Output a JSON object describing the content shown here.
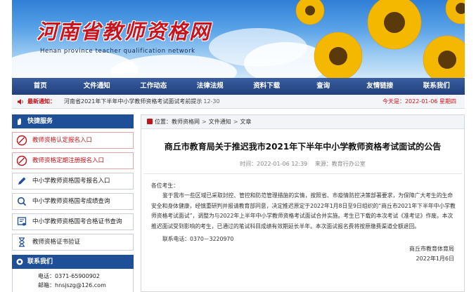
{
  "site": {
    "title": "河南省教师资格网",
    "subtitle": "Henan province teacher qualification network"
  },
  "nav": [
    "首页",
    "文件通知",
    "工作动态",
    "法律法规",
    "资料下载",
    "查询",
    "友情链接",
    "联系我们"
  ],
  "ticker": {
    "label": "最新通知：",
    "news": "河南省2021年下半年中小学教师资格考试面试考前提示",
    "news_date": "12-30",
    "today": "今天是：2022-01-06 星期四"
  },
  "sidebar": {
    "quick_title": "快捷服务",
    "items": [
      {
        "label": "教师资格认定报名入口",
        "style": "red",
        "icon": "no-entry-icon"
      },
      {
        "label": "教师资格定期注册报名入口",
        "style": "red",
        "icon": "no-entry-icon"
      },
      {
        "label": "中小学教师资格国考报名入口",
        "style": "normal",
        "icon": "pencil-icon"
      },
      {
        "label": "中小学教师资格国考成绩查询",
        "style": "normal",
        "icon": "search-icon"
      },
      {
        "label": "中小学教师资格国考合格证书查询",
        "style": "normal",
        "icon": "certificate-icon"
      },
      {
        "label": "教师资格证书验证",
        "style": "normal",
        "icon": "hourglass-icon"
      }
    ],
    "contact_title": "联系我们",
    "phone": "电话：0371-65900902",
    "email": "邮箱：hnsjszg@126.com"
  },
  "breadcrumb": {
    "prefix": "位置：",
    "items": [
      "教师资格网",
      "文件通知",
      "文章"
    ]
  },
  "article": {
    "title": "商丘市教育局关于推迟我市2021年下半年中小学教师资格考试面试的公告",
    "time": "时间：2022-01-06 12:39",
    "source": "来源：教育行办公室",
    "greeting": "各位考生：",
    "paragraph": "鉴于我市一些区域已采取封控、管控和防范管理措施的实情，按照省、市疫情防控决策部署要求，为保障广大考生的生命安全和身体健康，经慎重研判并报请教育部同意，决定推迟原定于2022年1月8日至9日组织的“商丘市2021年下半年中小学教师资格考试面试”，调整为与2022年上半年中小学教师资格考试面试合并实施。考生已下载的本次考试《准考证》作废。本次推迟面试受到影响的考生，已通过的笔试科目成绩有效期延长半年。本次面试报名费将按原缴费渠道全额退回。",
    "phone": "联系电话：0370－3220970",
    "signer": "商丘市教育体育局",
    "sign_date": "2022年1月6日"
  },
  "colors": {
    "nav_bg": "#223f7c",
    "accent_red": "#c0141b",
    "side_head": "#1f4f97"
  }
}
